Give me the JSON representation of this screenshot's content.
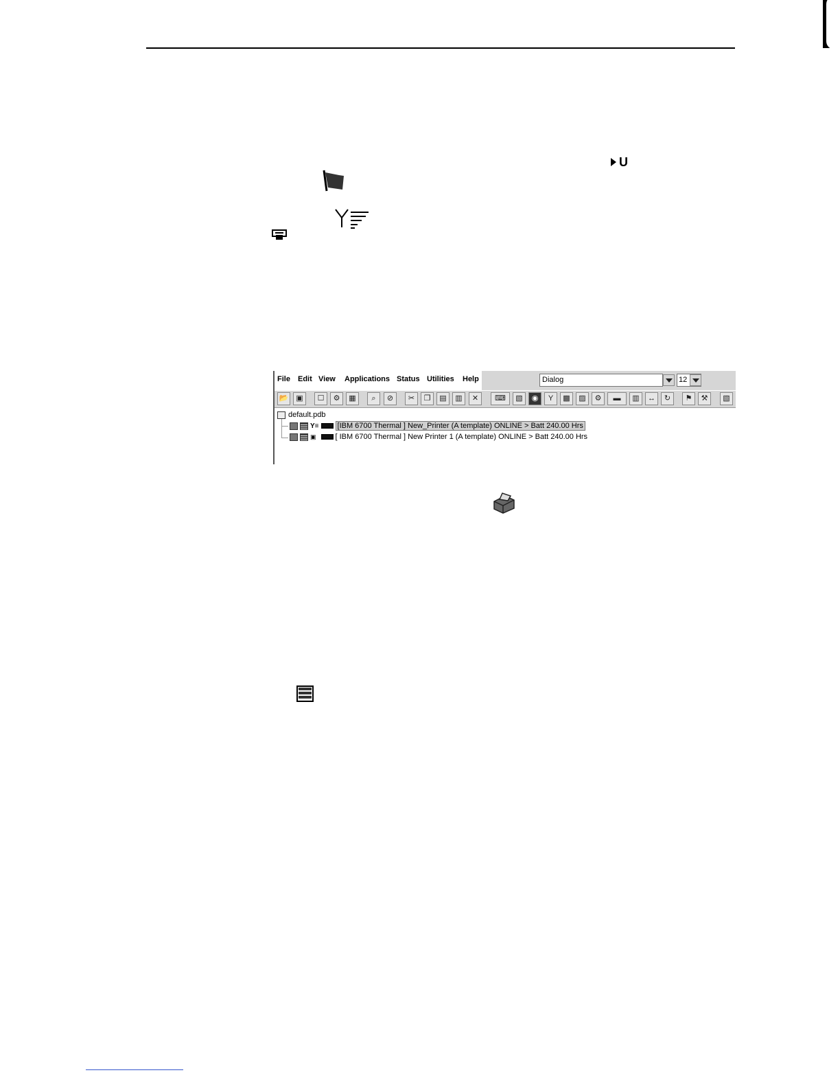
{
  "inline_text": {
    "bold_u": "U"
  },
  "window": {
    "menu": [
      "File",
      "Edit",
      "View",
      "Applications",
      "Status",
      "Utilities",
      "Help"
    ],
    "font_name": "Dialog",
    "font_size": "12",
    "toolbar_icons": [
      "open-icon",
      "save-icon",
      "new-printer-icon",
      "printer-settings-icon",
      "printer-add-icon",
      "find-icon",
      "stop-icon",
      "cut-icon",
      "copy-icon",
      "paste-icon",
      "paste-special-icon",
      "delete-icon",
      "keyboard-icon",
      "printer-icon",
      "disk-icon",
      "antenna-icon",
      "printer-status-icon",
      "printer-net-icon",
      "printer-gear-icon",
      "display-icon",
      "printer-file-icon",
      "connect-icon",
      "refresh-icon",
      "flag-icon",
      "tools-icon",
      "printer-help-icon"
    ],
    "tree": {
      "root": "default.pdb",
      "rows": [
        "[IBM 6700 Thermal ] New_Printer (A template) ONLINE > Batt 240.00 Hrs",
        "[ IBM 6700 Thermal ] New Printer 1 (A template) ONLINE > Batt 240.00 Hrs"
      ]
    }
  }
}
